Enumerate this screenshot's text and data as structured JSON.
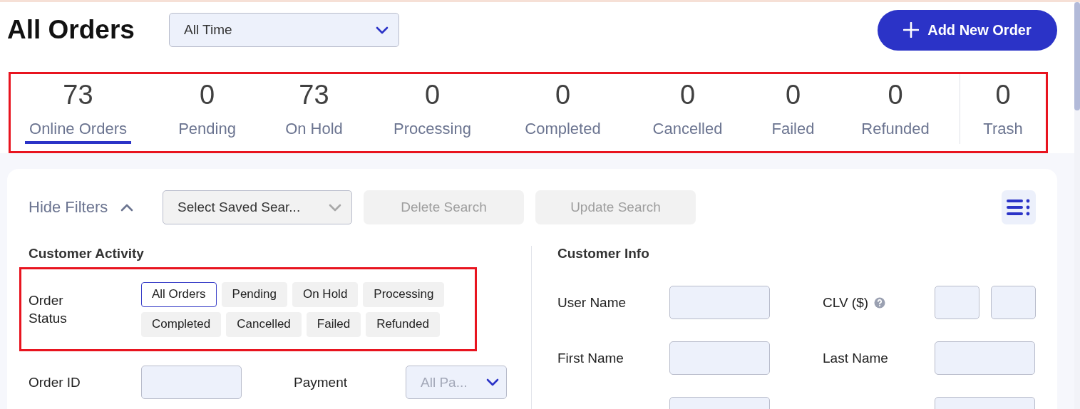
{
  "header": {
    "title": "All Orders",
    "date_filter": "All Time",
    "add_button": "Add New Order"
  },
  "stats_bar": {
    "highlighted": true,
    "items": [
      {
        "count": "73",
        "label": "Online Orders",
        "selected": true,
        "separated": false
      },
      {
        "count": "0",
        "label": "Pending",
        "selected": false,
        "separated": false
      },
      {
        "count": "73",
        "label": "On Hold",
        "selected": false,
        "separated": false
      },
      {
        "count": "0",
        "label": "Processing",
        "selected": false,
        "separated": false
      },
      {
        "count": "0",
        "label": "Completed",
        "selected": false,
        "separated": false
      },
      {
        "count": "0",
        "label": "Cancelled",
        "selected": false,
        "separated": false
      },
      {
        "count": "0",
        "label": "Failed",
        "selected": false,
        "separated": false
      },
      {
        "count": "0",
        "label": "Refunded",
        "selected": false,
        "separated": false
      },
      {
        "count": "0",
        "label": "Trash",
        "selected": false,
        "separated": true
      }
    ]
  },
  "filters": {
    "toggle": {
      "label": "Hide Filters",
      "expanded": true
    },
    "saved_search": "Select Saved Sear...",
    "buttons": [
      {
        "label": "Delete Search",
        "disabled": true
      },
      {
        "label": "Update Search",
        "disabled": true
      }
    ]
  },
  "customer_activity": {
    "title": "Customer Activity",
    "order_status": {
      "label": "Order Status",
      "highlighted": true,
      "chips": [
        {
          "label": "All Orders",
          "selected": true
        },
        {
          "label": "Pending",
          "selected": false
        },
        {
          "label": "On Hold",
          "selected": false
        },
        {
          "label": "Processing",
          "selected": false
        },
        {
          "label": "Completed",
          "selected": false
        },
        {
          "label": "Cancelled",
          "selected": false
        },
        {
          "label": "Failed",
          "selected": false
        },
        {
          "label": "Refunded",
          "selected": false
        }
      ]
    },
    "fields": [
      {
        "kind": "input",
        "label": "Order ID"
      },
      {
        "kind": "select",
        "label": "Payment",
        "value": "All Pa..."
      }
    ]
  },
  "customer_info": {
    "title": "Customer Info",
    "fields": [
      {
        "kind": "input",
        "label": "User Name"
      },
      {
        "kind": "range",
        "label": "CLV ($)",
        "help": true
      },
      {
        "kind": "input",
        "label": "First Name"
      },
      {
        "kind": "input",
        "label": "Last Name"
      },
      {
        "kind": "input"
      },
      {
        "kind": "input"
      }
    ]
  }
}
